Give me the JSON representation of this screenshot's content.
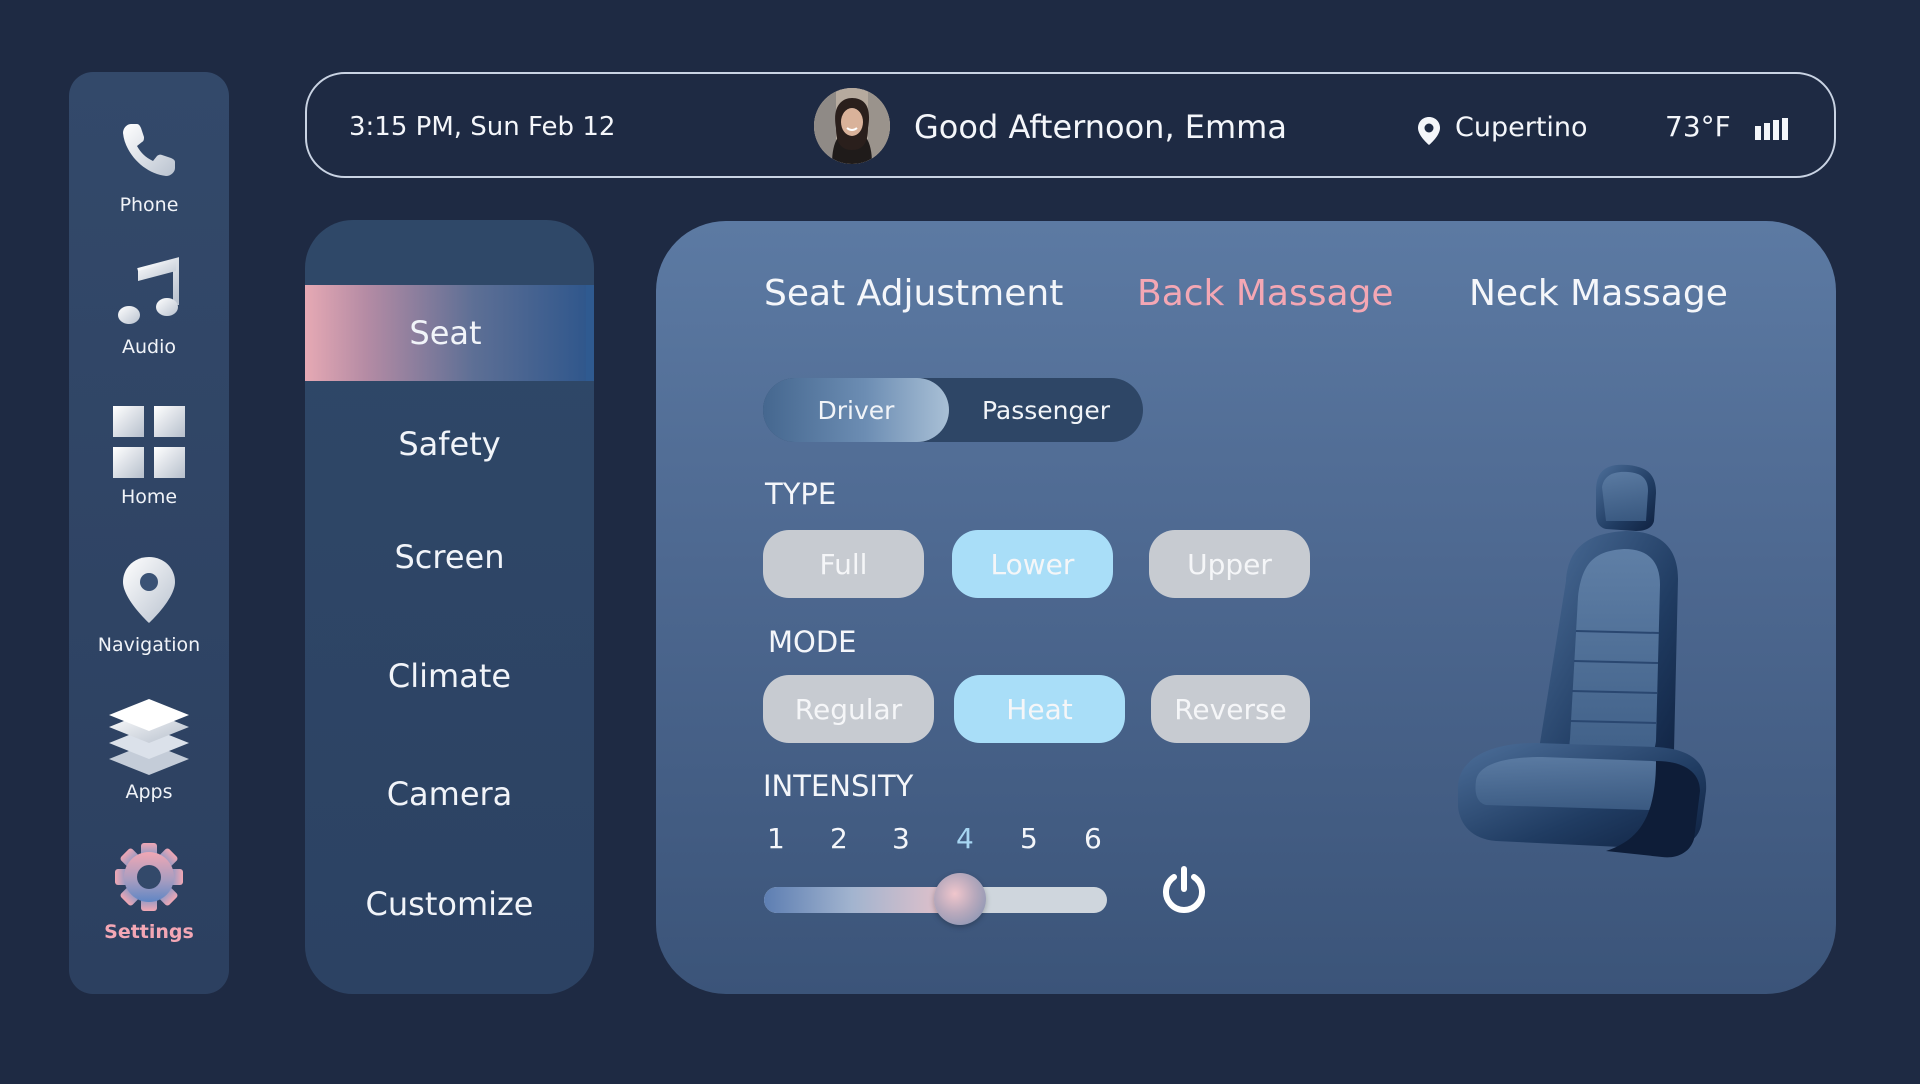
{
  "sidebar": {
    "items": [
      {
        "label": "Phone",
        "icon": "phone-icon"
      },
      {
        "label": "Audio",
        "icon": "music-note-icon"
      },
      {
        "label": "Home",
        "icon": "grid-icon"
      },
      {
        "label": "Navigation",
        "icon": "map-pin-icon"
      },
      {
        "label": "Apps",
        "icon": "layers-icon"
      },
      {
        "label": "Settings",
        "icon": "gear-icon",
        "active": true
      }
    ]
  },
  "header": {
    "datetime": "3:15 PM, Sun Feb 12",
    "greeting": "Good Afternoon, Emma",
    "location": "Cupertino",
    "temperature": "73°F",
    "signal_icon": "signal-bars-icon"
  },
  "menu": {
    "items": [
      "Seat",
      "Safety",
      "Screen",
      "Climate",
      "Camera",
      "Customize"
    ],
    "active": "Seat"
  },
  "panel": {
    "tabs": [
      "Seat Adjustment",
      "Back Massage",
      "Neck Massage"
    ],
    "active_tab": "Back Massage",
    "seat_toggle": {
      "options": [
        "Driver",
        "Passenger"
      ],
      "selected": "Driver"
    },
    "type": {
      "label": "TYPE",
      "options": [
        "Full",
        "Lower",
        "Upper"
      ],
      "selected": "Lower"
    },
    "mode": {
      "label": "MODE",
      "options": [
        "Regular",
        "Heat",
        "Reverse"
      ],
      "selected": "Heat"
    },
    "intensity": {
      "label": "INTENSITY",
      "levels": [
        "1",
        "2",
        "3",
        "4",
        "5",
        "6"
      ],
      "selected": "4",
      "value_fraction": 0.57
    },
    "power_icon": "power-icon",
    "seat_image": "car-seat-image"
  },
  "colors": {
    "background": "#1e2a43",
    "accent_pink": "#f4a7b4",
    "accent_blue": "#a9def8",
    "panel": "#4d6890"
  }
}
